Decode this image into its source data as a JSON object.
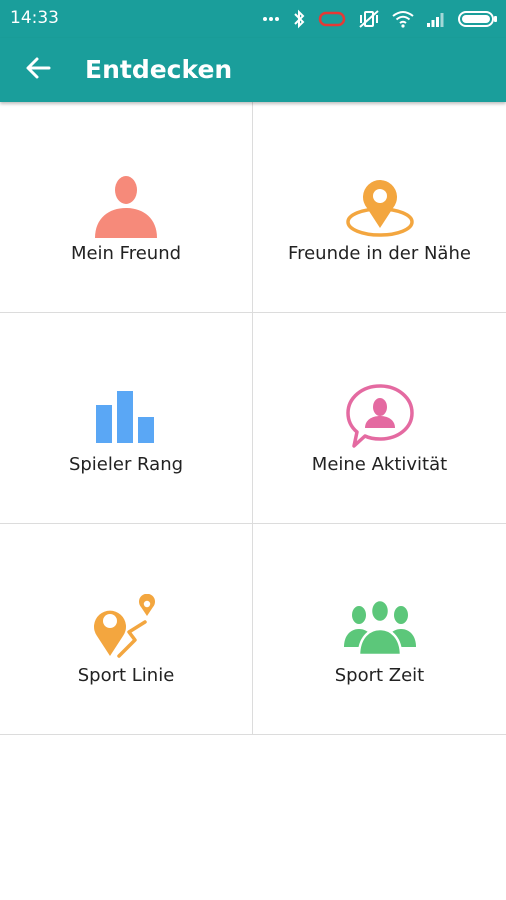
{
  "status_bar": {
    "time": "14:33",
    "icons": [
      "more-dots-icon",
      "bluetooth-icon",
      "battery-saver-icon",
      "vibrate-icon",
      "wifi-icon",
      "signal-icon",
      "battery-icon"
    ]
  },
  "app_bar": {
    "title": "Entdecken",
    "back_icon": "back-arrow-icon",
    "background_color": "#1a9e9b"
  },
  "grid": {
    "items": [
      {
        "label": "Mein Freund",
        "icon": "person-icon",
        "color": "#f68a7a"
      },
      {
        "label": "Freunde in der Nähe",
        "icon": "location-pin-icon",
        "color": "#f3a63f"
      },
      {
        "label": "Spieler Rang",
        "icon": "bar-chart-icon",
        "color": "#5aa7f5"
      },
      {
        "label": "Meine Aktivität",
        "icon": "chat-person-icon",
        "color": "#e46aa1"
      },
      {
        "label": "Sport Linie",
        "icon": "route-icon",
        "color": "#f3a63f"
      },
      {
        "label": "Sport Zeit",
        "icon": "group-icon",
        "color": "#5cc77a"
      }
    ]
  }
}
